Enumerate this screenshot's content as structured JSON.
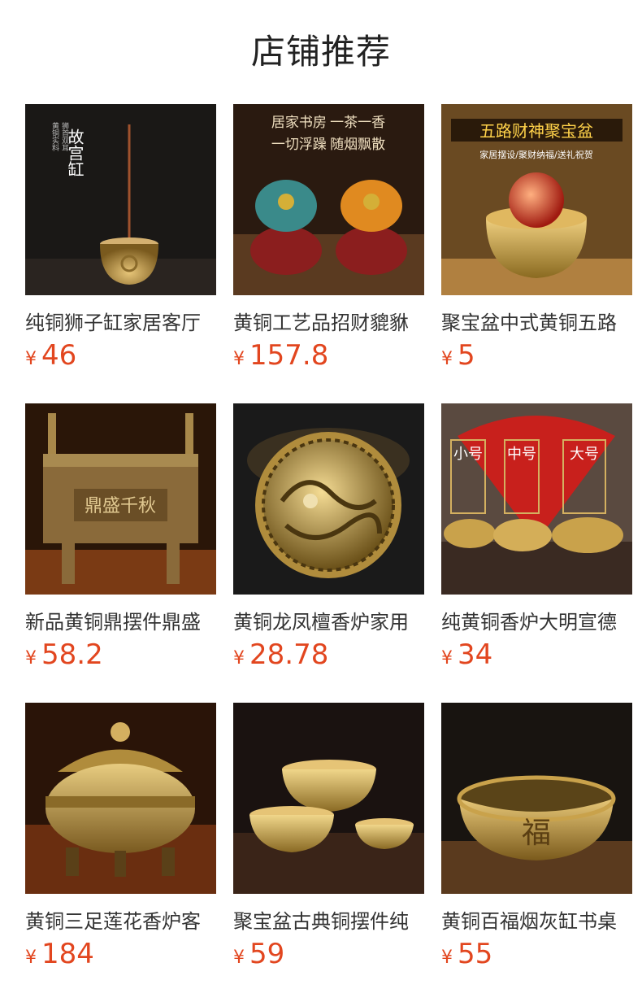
{
  "section": {
    "title": "店铺推荐"
  },
  "products": [
    {
      "name": "纯铜狮子缸家居客厅",
      "currency": "¥",
      "price": "46",
      "overlay": {
        "vertical_title": "故宫缸",
        "sub1": "黄铜实料",
        "sub2": "狮首双耳"
      }
    },
    {
      "name": "黄铜工艺品招财貔貅",
      "currency": "¥",
      "price": "157.8",
      "overlay": {
        "line1": "居家书房 一茶一香",
        "line2": "一切浮躁 随烟飘散"
      }
    },
    {
      "name": "聚宝盆中式黄铜五路",
      "currency": "¥",
      "price": "5",
      "overlay": {
        "line1": "五路财神聚宝盆",
        "line2": "家居摆设/聚财纳福/送礼祝贺"
      }
    },
    {
      "name": "新品黄铜鼎摆件鼎盛",
      "currency": "¥",
      "price": "58.2",
      "overlay": {
        "engraving": "鼎盛千秋"
      }
    },
    {
      "name": "黄铜龙凤檀香炉家用",
      "currency": "¥",
      "price": "28.78"
    },
    {
      "name": "纯黄铜香炉大明宣德",
      "currency": "¥",
      "price": "34",
      "overlay": {
        "small": "小号",
        "medium": "中号",
        "large": "大号"
      }
    },
    {
      "name": "黄铜三足莲花香炉客",
      "currency": "¥",
      "price": "184"
    },
    {
      "name": "聚宝盆古典铜摆件纯",
      "currency": "¥",
      "price": "59"
    },
    {
      "name": "黄铜百福烟灰缸书桌",
      "currency": "¥",
      "price": "55"
    }
  ],
  "colors": {
    "price": "#e2461f",
    "brass": "#c9a24b",
    "title": "#222222"
  }
}
